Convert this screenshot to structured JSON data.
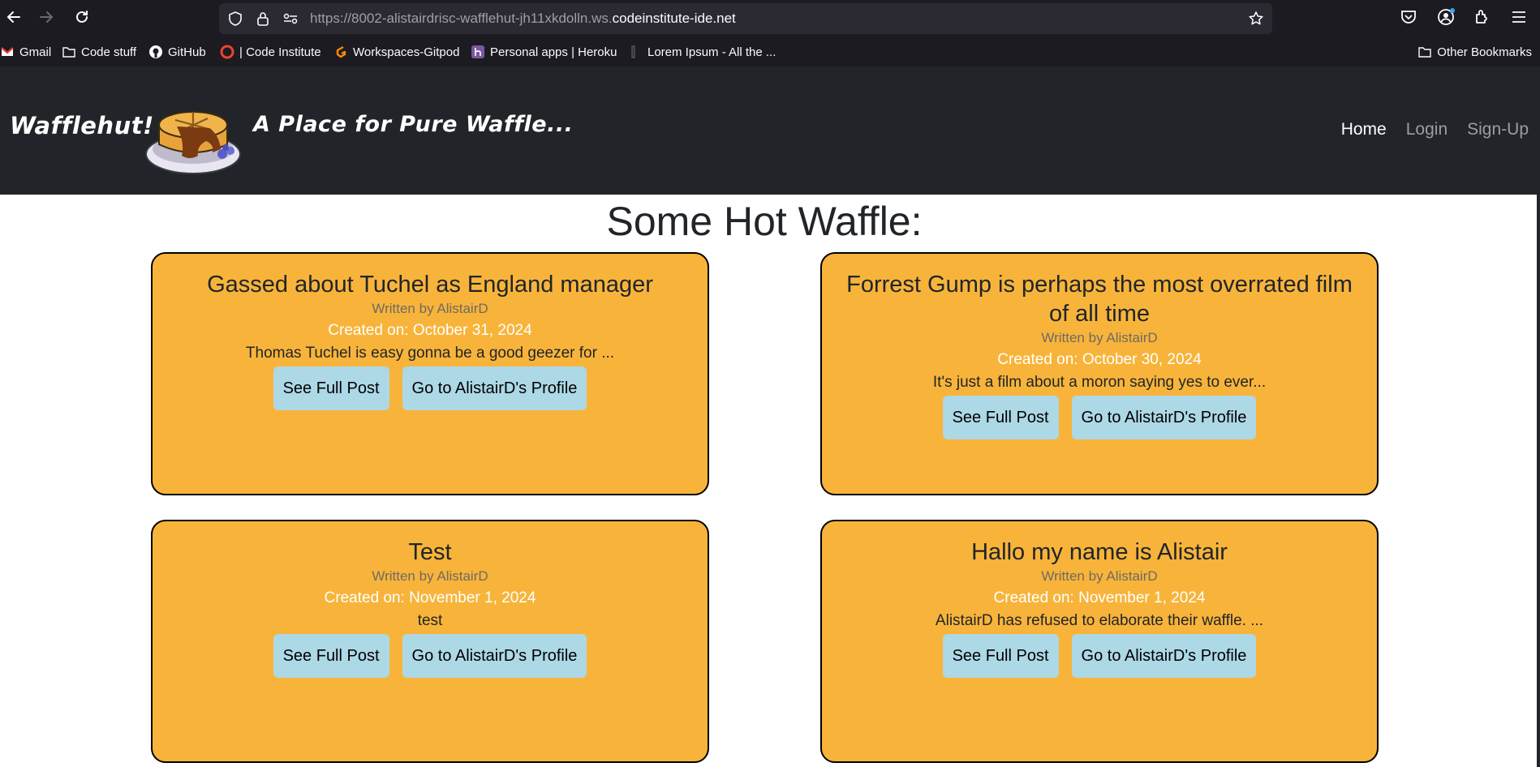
{
  "browser": {
    "url_prefix": "https://8002-alistairdrisc-wafflehut-jh11xkdolln.ws.",
    "url_domain": "codeinstitute-ide.net",
    "bookmarks": [
      {
        "label": "Gmail",
        "icon": "gmail-icon"
      },
      {
        "label": "Code stuff",
        "icon": "folder-icon"
      },
      {
        "label": "GitHub",
        "icon": "github-icon"
      },
      {
        "label": "| Code Institute",
        "icon": "code-institute-icon"
      },
      {
        "label": "Workspaces-Gitpod",
        "icon": "gitpod-icon"
      },
      {
        "label": "Personal apps | Heroku",
        "icon": "heroku-icon"
      },
      {
        "label": "Lorem Ipsum - All the ...",
        "icon": "lorem-ipsum-icon"
      }
    ],
    "other_bookmarks": "Other Bookmarks"
  },
  "site": {
    "brand": "Wafflehut!",
    "tagline": "A Place for Pure Waffle...",
    "nav": [
      {
        "label": "Home",
        "active": true
      },
      {
        "label": "Login",
        "active": false
      },
      {
        "label": "Sign-Up",
        "active": false
      }
    ]
  },
  "main": {
    "heading": "Some Hot Waffle:",
    "posts": [
      {
        "title": "Gassed about Tuchel as England manager",
        "author": "Written by AlistairD",
        "created": "Created on: October 31, 2024",
        "excerpt": "Thomas Tuchel is easy gonna be a good geezer for ...",
        "see_full_post": "See Full Post",
        "profile_button": "Go to AlistairD's Profile"
      },
      {
        "title": "Forrest Gump is perhaps the most overrated film of all time",
        "author": "Written by AlistairD",
        "created": "Created on: October 30, 2024",
        "excerpt": "It's just a film about a moron saying yes to ever...",
        "see_full_post": "See Full Post",
        "profile_button": "Go to AlistairD's Profile"
      },
      {
        "title": "Test",
        "author": "Written by AlistairD",
        "created": "Created on: November 1, 2024",
        "excerpt": "test",
        "see_full_post": "See Full Post",
        "profile_button": "Go to AlistairD's Profile"
      },
      {
        "title": "Hallo my name is Alistair",
        "author": "Written by AlistairD",
        "created": "Created on: November 1, 2024",
        "excerpt": "AlistairD has refused to elaborate their waffle. ...",
        "see_full_post": "See Full Post",
        "profile_button": "Go to AlistairD's Profile"
      }
    ]
  },
  "colors": {
    "card_bg": "#f8b43a",
    "button_bg": "#add8e6",
    "header_bg": "#212529"
  }
}
